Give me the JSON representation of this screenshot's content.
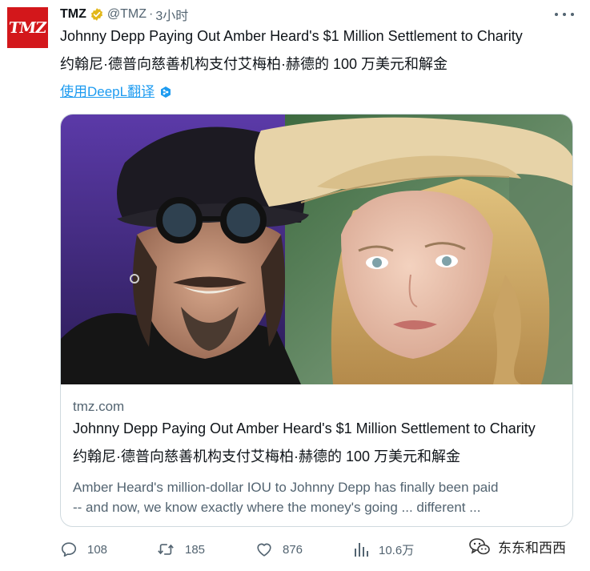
{
  "author": {
    "avatar_text": "TMZ",
    "name": "TMZ",
    "handle": "@TMZ",
    "separator": "·",
    "time": "3小时"
  },
  "tweet": {
    "text_line_1": "Johnny Depp Paying Out Amber Heard's $1 Million Settlement to Charity",
    "text_line_2": "约翰尼·德普向慈善机构支付艾梅柏·赫德的 100 万美元和解金",
    "translate_label": "使用DeepL翻译"
  },
  "card": {
    "domain": "tmz.com",
    "title": "Johnny Depp Paying Out Amber Heard's $1 Million Settlement to Charity",
    "title_translation": "约翰尼·德普向慈善机构支付艾梅柏·赫德的 100 万美元和解金",
    "description_line_1": "Amber Heard's million-dollar IOU to Johnny Depp has finally been paid",
    "description_line_2": "-- and now, we know exactly where the money's going ... different ..."
  },
  "actions": {
    "replies": "108",
    "retweets": "185",
    "likes": "876",
    "views": "10.6万"
  },
  "watermark": {
    "text": "东东和西西"
  },
  "icons": {
    "verified": "verified-badge-icon",
    "more": "more-options-icon",
    "deepl": "deepl-icon",
    "reply": "reply-icon",
    "retweet": "retweet-icon",
    "like": "heart-icon",
    "views": "views-icon",
    "watermark": "wechat-icon"
  },
  "colors": {
    "brand_red": "#d3171b",
    "link_blue": "#1d9bf0",
    "verified_gold": "#e2b719",
    "secondary_text": "#536471",
    "primary_text": "#0f1419",
    "border": "#cfd9de"
  }
}
